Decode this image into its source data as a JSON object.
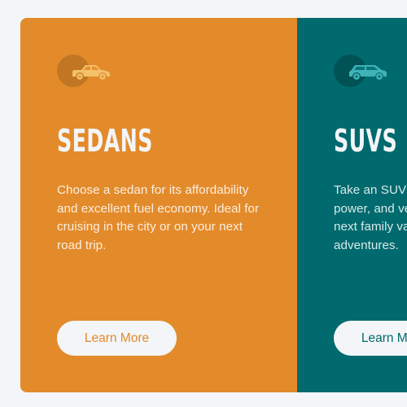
{
  "colors": {
    "page_background": "#f3f5f8",
    "sedans_card": "#e38b2b",
    "suvs_card": "#006a6e",
    "sedans_icon": "#f4c16a",
    "suvs_icon": "#3fb3b8",
    "button_background": "#f3f5f8"
  },
  "cards": [
    {
      "title": "SEDANS",
      "icon": "sedan-car-icon",
      "description": "Choose a sedan for its affordability and excellent fuel economy. Ideal for cruising in the city or on your next road trip.",
      "button_label": "Learn More"
    },
    {
      "title": "SUVS",
      "icon": "suv-car-icon",
      "description": "Take an SUV for its spacious interior, power, and versatility. Perfect for your next family vacation and off-road adventures.",
      "button_label": "Learn More"
    }
  ]
}
